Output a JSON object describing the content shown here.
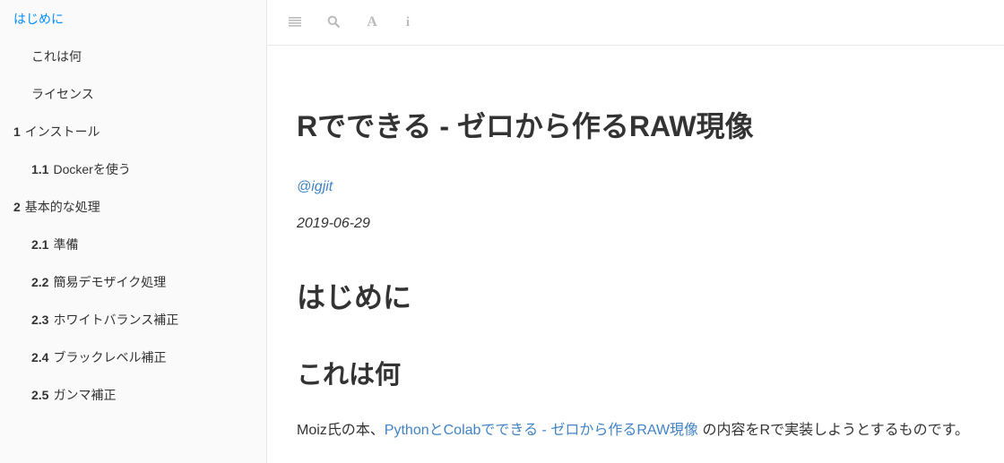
{
  "sidebar": {
    "items": [
      {
        "num": "",
        "label": "はじめに",
        "active": true,
        "level": 1
      },
      {
        "num": "",
        "label": "これは何",
        "active": false,
        "level": 2
      },
      {
        "num": "",
        "label": "ライセンス",
        "active": false,
        "level": 2
      },
      {
        "num": "1",
        "label": "インストール",
        "active": false,
        "level": 1
      },
      {
        "num": "1.1",
        "label": "Dockerを使う",
        "active": false,
        "level": 2
      },
      {
        "num": "2",
        "label": "基本的な処理",
        "active": false,
        "level": 1
      },
      {
        "num": "2.1",
        "label": "準備",
        "active": false,
        "level": 2
      },
      {
        "num": "2.2",
        "label": "簡易デモザイク処理",
        "active": false,
        "level": 2
      },
      {
        "num": "2.3",
        "label": "ホワイトバランス補正",
        "active": false,
        "level": 2
      },
      {
        "num": "2.4",
        "label": "ブラックレベル補正",
        "active": false,
        "level": 2
      },
      {
        "num": "2.5",
        "label": "ガンマ補正",
        "active": false,
        "level": 2
      }
    ]
  },
  "toolbar": {
    "toc_icon": "menu-icon",
    "search_icon": "search-icon",
    "font_icon": "font-settings-icon",
    "font_glyph": "A",
    "info_icon": "info-icon",
    "info_glyph": "i"
  },
  "main": {
    "title": "Rでできる - ゼロから作るRAW現像",
    "author": "@igjit",
    "date": "2019-06-29",
    "section_title": "はじめに",
    "subsection_title": "これは何",
    "paragraph": {
      "before": "Moiz氏の本、",
      "link_text": "PythonとColabでできる - ゼロから作るRAW現像",
      "after": " の内容をRで実装しようとするものです。"
    }
  },
  "colors": {
    "accent": "#008cff",
    "link": "#4183c4",
    "text": "#333333",
    "icon": "#bbbbbb"
  }
}
